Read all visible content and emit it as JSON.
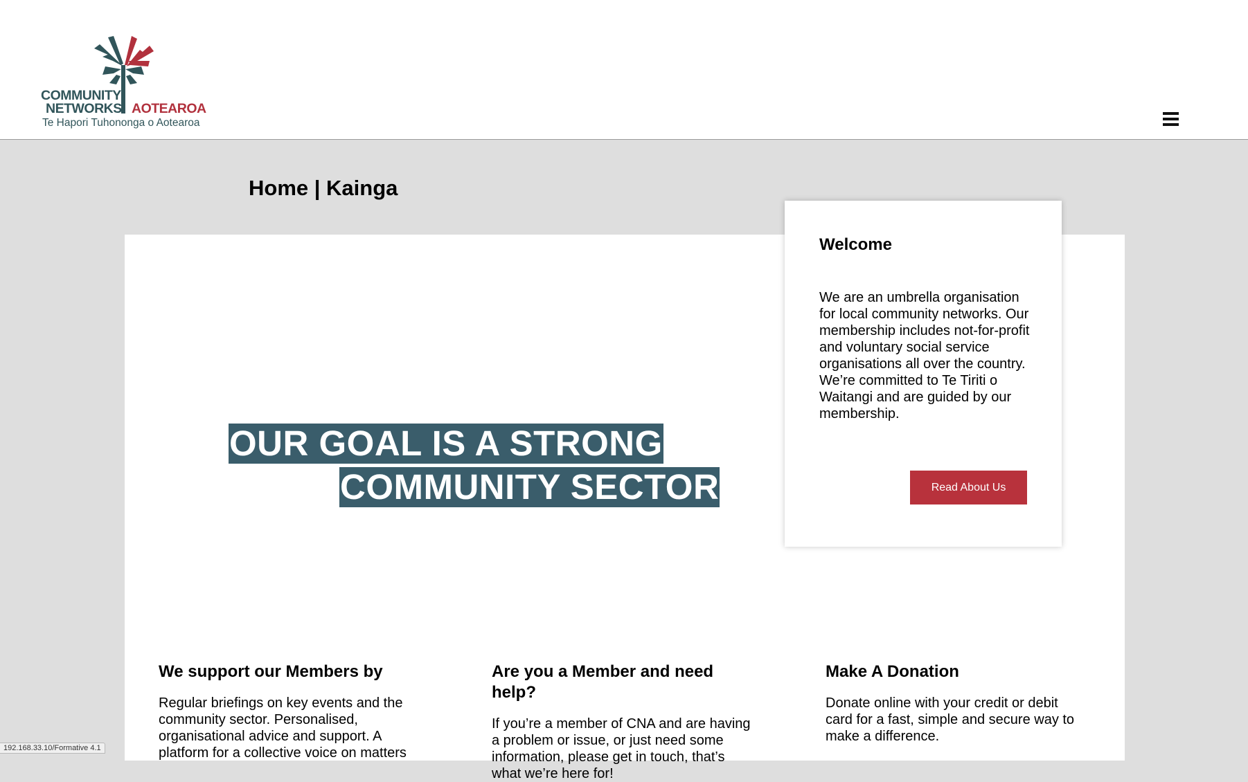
{
  "header": {
    "logo": {
      "line1": "COMMUNITY",
      "line2": "NETWORKS",
      "line2_accent": "AOTEAROA",
      "subtitle": "Te Hapori Tuhononga o Aotearoa"
    },
    "menu_icon": "hamburger-menu-icon"
  },
  "page_title": "Home | Kainga",
  "hero": {
    "line1": "OUR GOAL IS A STRONG",
    "line2": "COMMUNITY SECTOR"
  },
  "welcome": {
    "title": "Welcome",
    "text": "We are an umbrella organisation for local community networks. Our membership includes not-for-profit and voluntary social service organisations all over the country. We’re committed to Te Tiriti o Waitangi and are guided by our membership.",
    "button_label": "Read About Us"
  },
  "columns": [
    {
      "title": "We support our Members by",
      "text": "Regular briefings on key events and the community sector. Personalised, organisational advice and support. A platform for a collective voice on matters"
    },
    {
      "title": "Are you a Member and need help?",
      "text": "If you’re a member of CNA and are having a problem or issue, or just need some information, please get in touch, that’s what we’re here for!"
    },
    {
      "title": "Make A Donation",
      "text": "Donate online with your credit or debit card for a fast, simple and secure way to make a difference."
    }
  ],
  "status_bar": {
    "url": "192.168.33.10/Formative 4.1"
  },
  "colors": {
    "hero_highlight": "#3a5d6b",
    "button": "#b8323c",
    "logo_teal": "#31555a",
    "logo_red": "#b1313d",
    "page_background": "#dedede"
  }
}
